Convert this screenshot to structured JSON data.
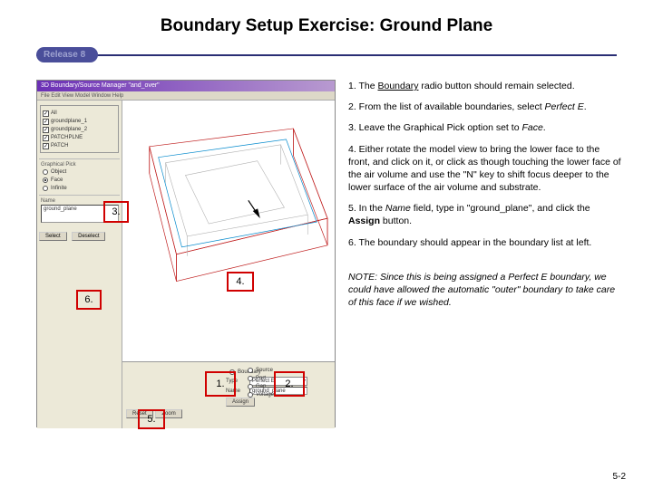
{
  "title": "Boundary Setup Exercise: Ground Plane",
  "release_label": "Release 8",
  "screenshot": {
    "window_title": "3D Boundary/Source Manager  \"and_over\"",
    "menubar": "File  Edit  View  Model  Window  Help",
    "left_panel": {
      "visibility": {
        "items": [
          {
            "label": "All",
            "checked": true
          },
          {
            "label": "groundplane_1",
            "checked": true
          },
          {
            "label": "groundplane_2",
            "checked": true
          },
          {
            "label": "PATCHPLNE",
            "checked": true
          },
          {
            "label": "PATCH",
            "checked": true
          }
        ]
      },
      "graphical_pick_label": "Graphical Pick",
      "pick_options": [
        {
          "label": "Object",
          "selected": false
        },
        {
          "label": "Face",
          "selected": true
        },
        {
          "label": "Infinite",
          "selected": false
        }
      ],
      "name_label": "Name",
      "name_value": "ground_plane",
      "btn_select": "Select",
      "btn_deselect": "Deselect"
    },
    "bottom_panel": {
      "left_btns": [
        "Reset",
        "Zoom"
      ],
      "mid": {
        "boundary_label": "Boundary",
        "type_label": "Type",
        "name_label": "Name",
        "type_value": "Perfect E",
        "name_value": "ground_plane",
        "btn_assign": "Assign"
      },
      "right": {
        "source_label": "Source",
        "type_label": "",
        "options": [
          "Port",
          "Gap",
          "Voltage"
        ]
      }
    }
  },
  "steps": {
    "s1_a": "1.  The ",
    "s1_term": "Boundary",
    "s1_b": " radio button should remain selected.",
    "s2_a": "2.  From the list of available boundaries, select ",
    "s2_term": "Perfect E",
    "s2_b": ".",
    "s3_a": "3.  Leave the Graphical Pick option set to ",
    "s3_term": "Face",
    "s3_b": ".",
    "s4": "4.  Either rotate the model view to bring the lower face to the front, and click on it, or click as though touching the lower face of the air volume and use the \"N\" key to shift focus deeper to the lower surface of the air volume and substrate.",
    "s5_a": "5. In the ",
    "s5_term1": "Name",
    "s5_b": " field, type in \"ground_plane\", and click the ",
    "s5_term2": "Assign",
    "s5_c": " button.",
    "s6": "6. The boundary should appear in the boundary list at left.",
    "note": "NOTE:  Since this is being assigned a Perfect E boundary, we could have allowed the automatic \"outer\" boundary to take care of this face if we wished."
  },
  "callouts": {
    "c1": "1.",
    "c2": "2.",
    "c3": "3.",
    "c4": "4.",
    "c5": "5.",
    "c6": "6."
  },
  "page_number": "5-2"
}
